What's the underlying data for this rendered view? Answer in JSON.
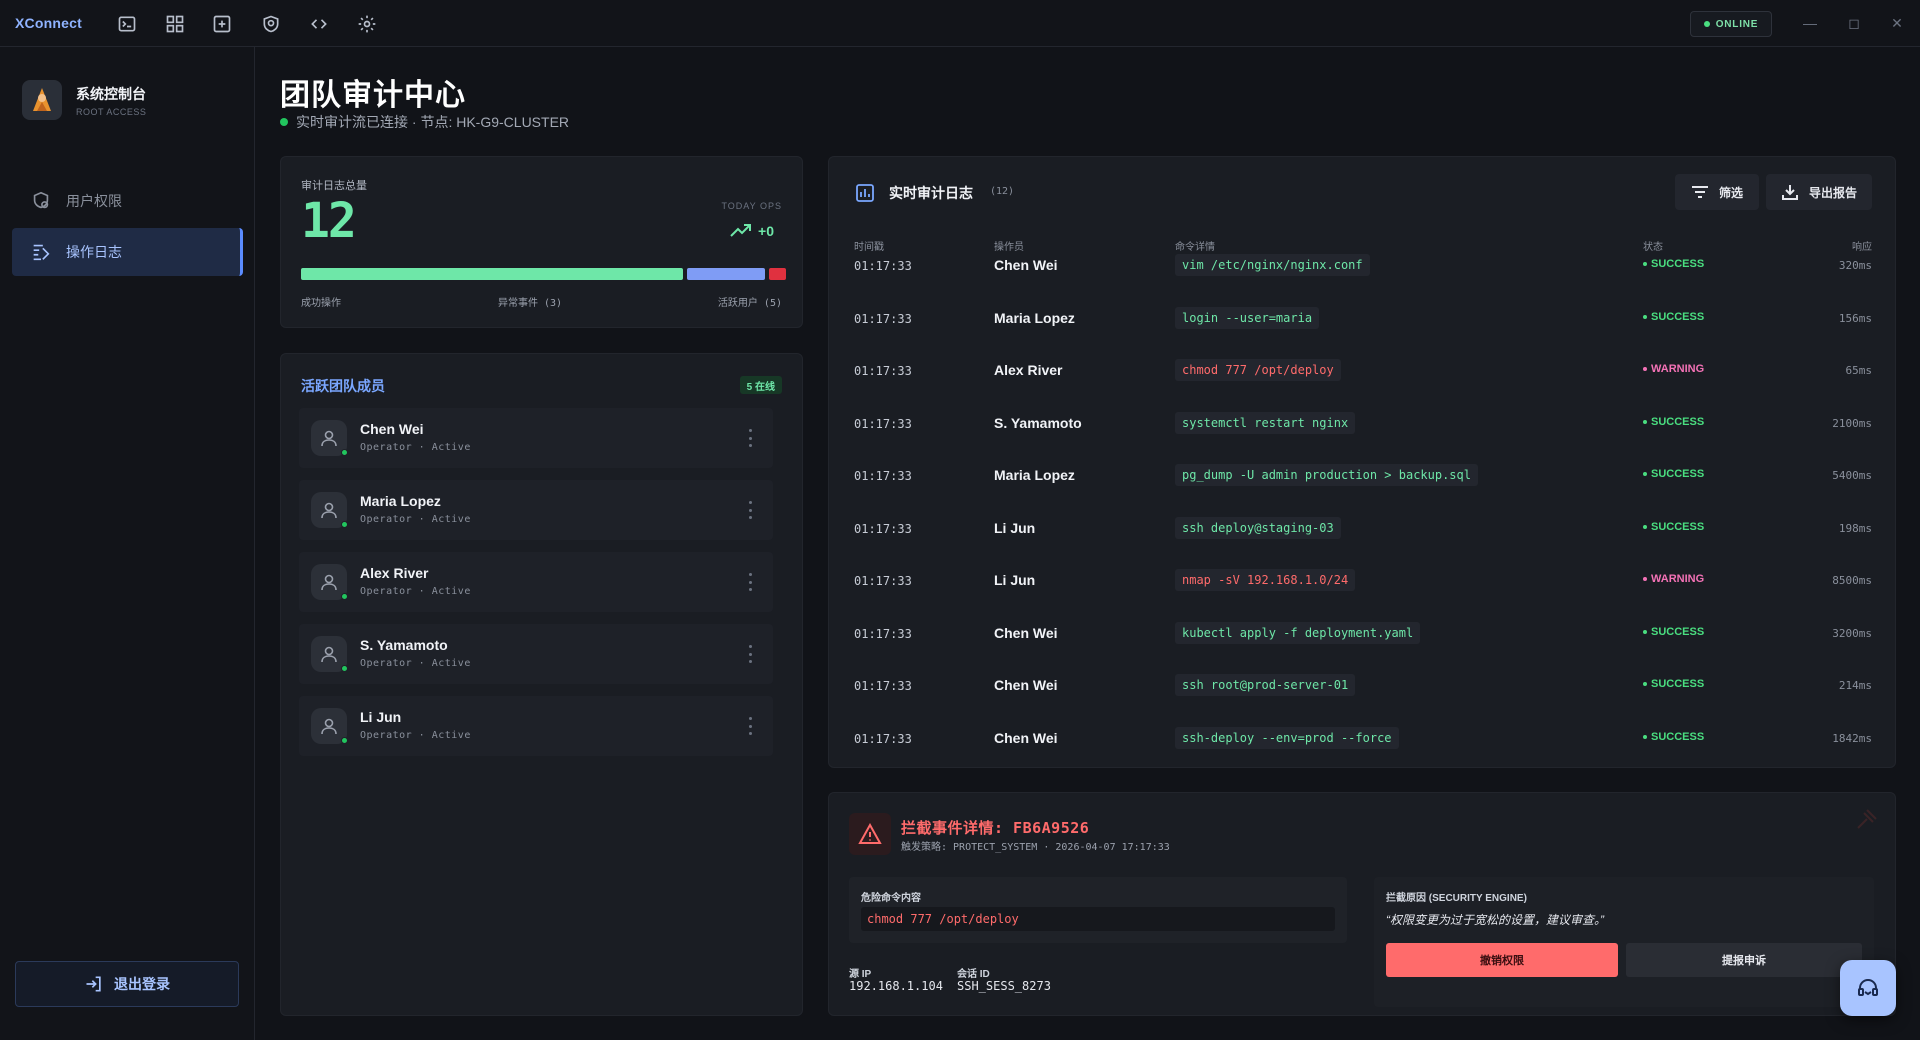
{
  "app": {
    "brand": "XConnect",
    "connection_status": "ONLINE"
  },
  "toolbar": {
    "icons": [
      "terminal-icon",
      "grid-icon",
      "add-square-icon",
      "shield-icon",
      "code-icon",
      "gear-icon"
    ]
  },
  "window_controls": {
    "minimize": "—",
    "maximize": "◻",
    "close": "✕"
  },
  "sidebar": {
    "profile": {
      "title": "系统控制台",
      "subtitle": "ROOT ACCESS"
    },
    "items": [
      {
        "label": "用户权限",
        "icon": "shield-user-icon",
        "active": false
      },
      {
        "label": "操作日志",
        "icon": "log-icon",
        "active": true
      }
    ],
    "logout_label": "退出登录"
  },
  "header": {
    "title": "团队审计中心",
    "subtitle": "实时审计流已连接 · 节点: HK-G9-CLUSTER"
  },
  "stats": {
    "label": "审计日志总量",
    "value": "12",
    "today_label": "TODAY OPS",
    "trend": "+0",
    "progress": {
      "success": 0.8,
      "anomaly": 0.165,
      "users": 0.035
    },
    "legend": {
      "success": "成功操作",
      "anomaly": "异常事件 (3)",
      "users": "活跃用户 (5)"
    },
    "colors": {
      "success": "#6ee7a8",
      "anomaly": "#7f9cf5",
      "users": "#e0313f"
    }
  },
  "team": {
    "title": "活跃团队成员",
    "online_badge": "5 在线",
    "members": [
      {
        "name": "Chen Wei",
        "role": "Operator · Active"
      },
      {
        "name": "Maria Lopez",
        "role": "Operator · Active"
      },
      {
        "name": "Alex River",
        "role": "Operator · Active"
      },
      {
        "name": "S. Yamamoto",
        "role": "Operator · Active"
      },
      {
        "name": "Li Jun",
        "role": "Operator · Active"
      }
    ]
  },
  "logs": {
    "title": "实时审计日志",
    "count": "(12)",
    "filter_label": "筛选",
    "export_label": "导出报告",
    "columns": {
      "time": "时间戳",
      "operator": "操作员",
      "command": "命令详情",
      "status": "状态",
      "response": "响应"
    },
    "rows": [
      {
        "time": "01:17:33",
        "user": "Chen Wei",
        "cmd": "vim /etc/nginx/nginx.conf",
        "status": "SUCCESS",
        "resp": "320ms"
      },
      {
        "time": "01:17:33",
        "user": "Maria Lopez",
        "cmd": "login --user=maria",
        "status": "SUCCESS",
        "resp": "156ms"
      },
      {
        "time": "01:17:33",
        "user": "Alex River",
        "cmd": "chmod 777 /opt/deploy",
        "status": "WARNING",
        "resp": "65ms"
      },
      {
        "time": "01:17:33",
        "user": "S. Yamamoto",
        "cmd": "systemctl restart nginx",
        "status": "SUCCESS",
        "resp": "2100ms"
      },
      {
        "time": "01:17:33",
        "user": "Maria Lopez",
        "cmd": "pg_dump -U admin production > backup.sql",
        "status": "SUCCESS",
        "resp": "5400ms"
      },
      {
        "time": "01:17:33",
        "user": "Li Jun",
        "cmd": "ssh deploy@staging-03",
        "status": "SUCCESS",
        "resp": "198ms"
      },
      {
        "time": "01:17:33",
        "user": "Li Jun",
        "cmd": "nmap -sV 192.168.1.0/24",
        "status": "WARNING",
        "resp": "8500ms"
      },
      {
        "time": "01:17:33",
        "user": "Chen Wei",
        "cmd": "kubectl apply -f deployment.yaml",
        "status": "SUCCESS",
        "resp": "3200ms"
      },
      {
        "time": "01:17:33",
        "user": "Chen Wei",
        "cmd": "ssh root@prod-server-01",
        "status": "SUCCESS",
        "resp": "214ms"
      },
      {
        "time": "01:17:33",
        "user": "Chen Wei",
        "cmd": "ssh-deploy --env=prod --force",
        "status": "SUCCESS",
        "resp": "1842ms"
      }
    ]
  },
  "incident": {
    "title": "拦截事件详情: FB6A9526",
    "subtitle": "触发策略: PROTECT_SYSTEM · 2026-04-07 17:17:33",
    "command_label": "危险命令内容",
    "command": "chmod 777 /opt/deploy",
    "src_ip_label": "源 IP",
    "src_ip": "192.168.1.104",
    "session_label": "会话 ID",
    "session": "SSH_SESS_8273",
    "reason_label": "拦截原因 (SECURITY ENGINE)",
    "reason": "“权限变更为过于宽松的设置，建议审查。”",
    "revoke_label": "撤销权限",
    "appeal_label": "提报申诉"
  },
  "colors": {
    "success": "#4ade80",
    "warning": "#f472b6",
    "danger": "#ff6b6b",
    "accent": "#7aa7ff",
    "cmd_ok": "#6ee7a8"
  }
}
